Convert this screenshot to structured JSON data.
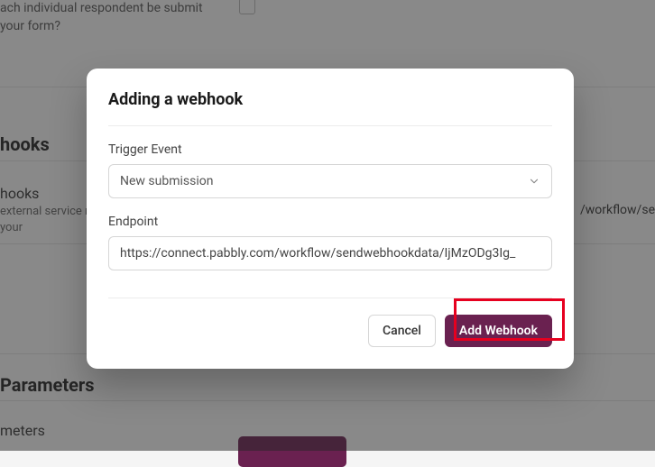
{
  "background": {
    "top_question_fragment": "ach individual respondent be submit your form?",
    "hooks_heading": "hooks",
    "hooks_subheading": "hooks",
    "hooks_description": "external service ne submits your",
    "url_fragment_right": "/workflow/se",
    "parameters_heading": "Parameters",
    "meters_fragment": "meters"
  },
  "modal": {
    "title": "Adding a webhook",
    "trigger_event": {
      "label": "Trigger Event",
      "selected": "New submission"
    },
    "endpoint": {
      "label": "Endpoint",
      "value": "https://connect.pabbly.com/workflow/sendwebhookdata/IjMzODg3Ig_"
    },
    "buttons": {
      "cancel": "Cancel",
      "submit": "Add Webhook"
    }
  },
  "colors": {
    "primary": "#6a2150",
    "highlight": "#e6001f"
  }
}
